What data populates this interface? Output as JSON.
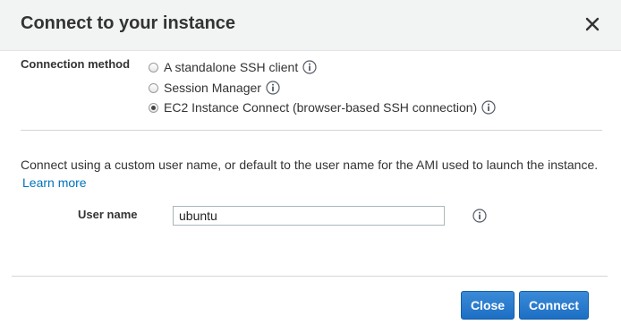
{
  "dialog": {
    "title": "Connect to your instance",
    "close_icon": "close-x-icon"
  },
  "connection_method": {
    "label": "Connection method",
    "options": [
      {
        "label": "A standalone SSH client",
        "selected": false,
        "info_icon": "info-icon"
      },
      {
        "label": "Session Manager",
        "selected": false,
        "info_icon": "info-icon"
      },
      {
        "label": "EC2 Instance Connect (browser-based SSH connection)",
        "selected": true,
        "info_icon": "info-icon"
      }
    ]
  },
  "description": {
    "text": "Connect using a custom user name, or default to the user name for the AMI used to launch the instance.",
    "learn_more": "Learn more"
  },
  "user_name": {
    "label": "User name",
    "value": "ubuntu",
    "info_icon": "info-icon"
  },
  "footer": {
    "close_label": "Close",
    "connect_label": "Connect"
  },
  "colors": {
    "header_bg": "#f2f3f3",
    "primary_button": "#1d6fc4",
    "link": "#0073bb"
  }
}
